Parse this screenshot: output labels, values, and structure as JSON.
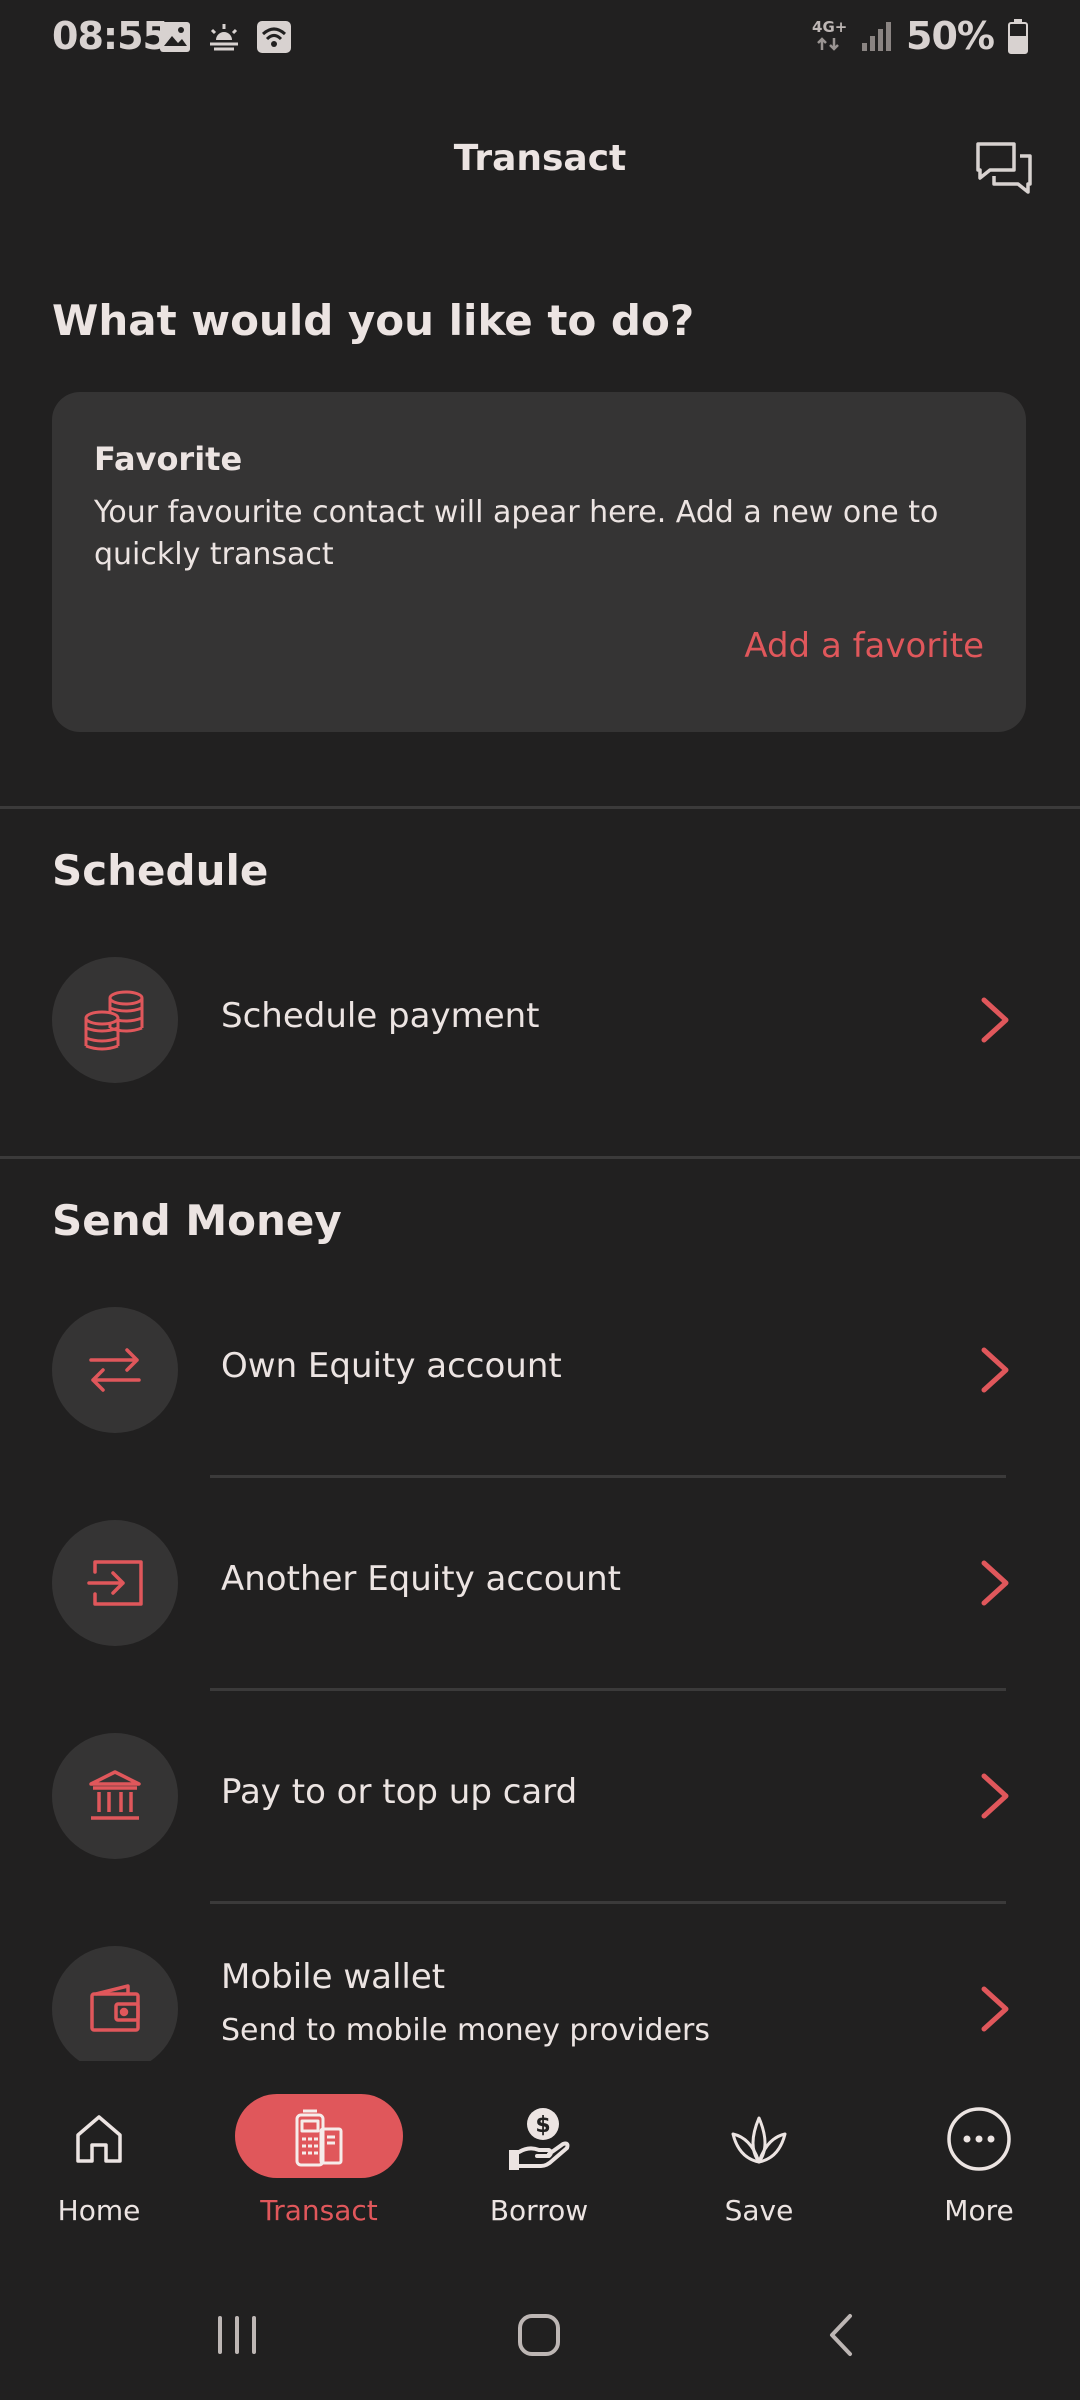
{
  "status_bar": {
    "time": "08:55",
    "network": "4G+",
    "battery": "50%"
  },
  "header": {
    "title": "Transact",
    "chat_icon": "chat-icon"
  },
  "intro": {
    "heading": "What would you like to do?"
  },
  "favorite_card": {
    "title": "Favorite",
    "description": "Your favourite contact will apear here. Add a new one to quickly transact",
    "action": "Add a favorite"
  },
  "schedule": {
    "heading": "Schedule",
    "items": [
      {
        "label": "Schedule payment",
        "icon": "coins-icon"
      }
    ]
  },
  "send_money": {
    "heading": "Send Money",
    "items": [
      {
        "label": "Own Equity account",
        "icon": "transfer-arrows-icon"
      },
      {
        "label": "Another Equity account",
        "icon": "account-transfer-icon"
      },
      {
        "label": "Pay to or top up card",
        "icon": "bank-icon"
      },
      {
        "label": "Mobile wallet",
        "sublabel": "Send to mobile money providers",
        "icon": "wallet-icon"
      }
    ]
  },
  "bottom_nav": {
    "items": [
      {
        "label": "Home",
        "icon": "home-icon"
      },
      {
        "label": "Transact",
        "icon": "pos-terminal-icon",
        "active": true
      },
      {
        "label": "Borrow",
        "icon": "hand-money-icon"
      },
      {
        "label": "Save",
        "icon": "plant-icon"
      },
      {
        "label": "More",
        "icon": "more-dots-icon"
      }
    ]
  },
  "colors": {
    "background": "#212020",
    "card": "#353434",
    "accent": "#e0575b",
    "text": "#ece4e2"
  }
}
